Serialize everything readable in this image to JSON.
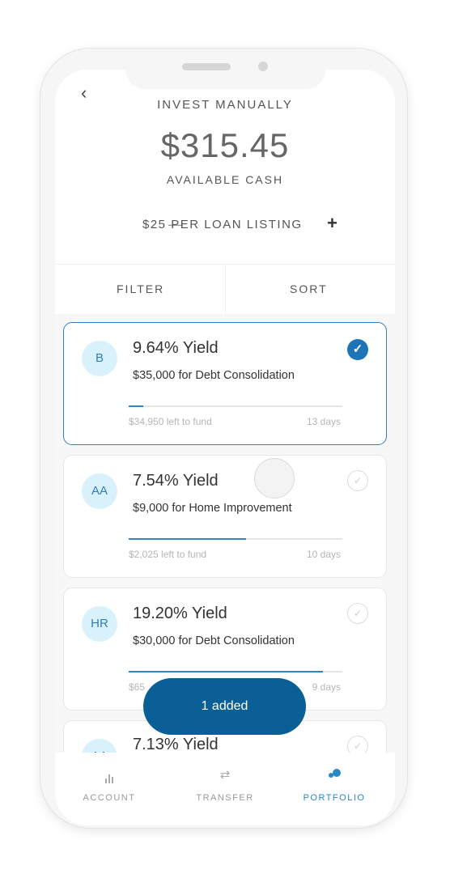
{
  "header": {
    "back_glyph": "‹",
    "title": "INVEST MANUALLY",
    "amount": "$315.45",
    "amount_label": "AVAILABLE CASH",
    "minus_glyph": "—",
    "per_loan": "$25 PER LOAN LISTING",
    "plus_glyph": "+"
  },
  "controls": {
    "filter": "FILTER",
    "sort": "SORT"
  },
  "loans": [
    {
      "grade": "B",
      "yield": "9.64% Yield",
      "desc": "$35,000 for Debt Consolidation",
      "left": "$34,950 left to fund",
      "days": "13 days",
      "funded_fraction": 0.07,
      "selected": true
    },
    {
      "grade": "AA",
      "yield": "7.54% Yield",
      "desc": "$9,000 for Home Improvement",
      "left": "$2,025 left to fund",
      "days": "10 days",
      "funded_fraction": 0.55,
      "selected": false
    },
    {
      "grade": "HR",
      "yield": "19.20% Yield",
      "desc": "$30,000 for Debt Consolidation",
      "left": "$65",
      "days": "9 days",
      "funded_fraction": 0.91,
      "selected": false
    },
    {
      "grade": "AA",
      "yield": "7.13% Yield",
      "selected": false
    }
  ],
  "toast": "1 added",
  "tabs": [
    {
      "label": "ACCOUNT",
      "icon": "bar-chart-icon"
    },
    {
      "label": "TRANSFER",
      "icon": "transfer-icon"
    },
    {
      "label": "PORTFOLIO",
      "icon": "portfolio-icon",
      "active": true
    }
  ],
  "colors": {
    "accent": "#1d74b8",
    "toast": "#0a5f96",
    "grade_bg": "#d9f1fb"
  }
}
